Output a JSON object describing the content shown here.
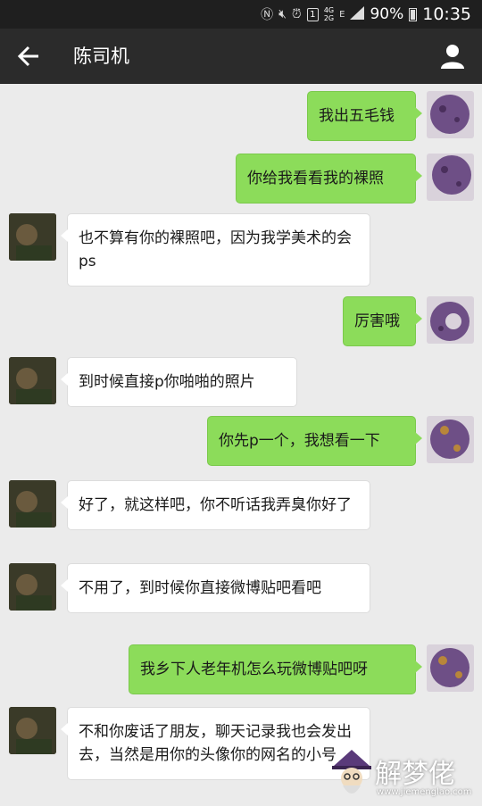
{
  "status_bar": {
    "network_top": "4G",
    "network_bottom": "2G",
    "sim": "1",
    "signal_label": "E",
    "battery_percent": "90%",
    "time": "10:35"
  },
  "header": {
    "title": "陈司机"
  },
  "messages": [
    {
      "side": "right",
      "text": "我出五毛钱"
    },
    {
      "side": "right",
      "text": "你给我看看我的裸照"
    },
    {
      "side": "left",
      "text": "也不算有你的裸照吧，因为我学美术的会ps"
    },
    {
      "side": "right",
      "text": "厉害哦"
    },
    {
      "side": "left",
      "text": "到时候直接p你啪啪的照片"
    },
    {
      "side": "right",
      "text": "你先p一个，我想看一下"
    },
    {
      "side": "left",
      "text": "好了，就这样吧，你不听话我弄臭你好了"
    },
    {
      "side": "left",
      "text": "不用了，到时候你直接微博贴吧看吧"
    },
    {
      "side": "right",
      "text": "我乡下人老年机怎么玩微博贴吧呀"
    },
    {
      "side": "left",
      "text": "不和你废话了朋友，聊天记录我也会发出去，当然是用你的头像你的网名的小号"
    }
  ],
  "watermark": {
    "text": "解梦佬",
    "url": "www.jiemenglao.com"
  },
  "colors": {
    "status_bar": "#1f1f1f",
    "title_bar": "#2b2b2b",
    "chat_background": "#ebebeb",
    "bubble_sent": "#8cdc5a",
    "bubble_received": "#ffffff"
  }
}
